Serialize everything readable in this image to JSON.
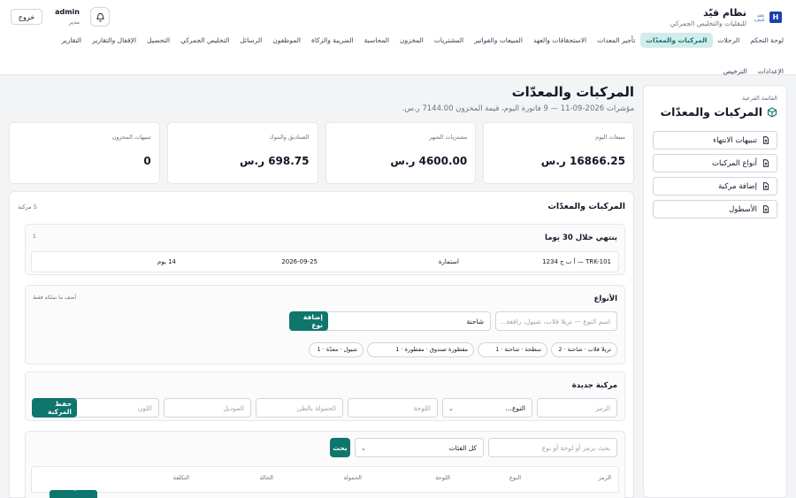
{
  "brand": {
    "logo_text": "H",
    "logo_tag": "ناقلة التجارة",
    "title": "نظام قيّد",
    "subtitle": "للنقليات والتخليص الجمركي"
  },
  "user": {
    "name": "admin",
    "role": "مدير",
    "logout_label": "خروج"
  },
  "nav": {
    "items": [
      "لوحة التحكم",
      "الرحلات",
      "المركبات والمعدّات",
      "تأجير المعدات",
      "الاستحقاقات والعهد",
      "المبيعات والفواتير",
      "المشتريات",
      "المخزون",
      "المحاسبة",
      "الضريبة والزكاة",
      "الموظفون",
      "الرسائل",
      "التخليص الجمركي",
      "التحصيل",
      "الإقفال والتقارير",
      "التقارير",
      "الإعدادات",
      "الترخيص"
    ],
    "active_index": 2
  },
  "sidebar": {
    "caption": "القائمة الفرعية",
    "title": "المركبات والمعدّات",
    "links": [
      "تنبيهات الانتهاء",
      "أنواع المركبات",
      "إضافة مركبة",
      "الأسطول"
    ]
  },
  "page": {
    "title": "المركبات والمعدّات",
    "meta": "مؤشرات 2026-09-11 — 9 فاتورة اليوم، قيمة المخزون 7144.00 ر.س."
  },
  "stats": [
    {
      "label": "مبيعات اليوم",
      "value": "16866.25 ر.س"
    },
    {
      "label": "مشتريات الشهر",
      "value": "4600.00 ر.س"
    },
    {
      "label": "الصناديق والبنوك",
      "value": "698.75 ر.س"
    },
    {
      "label": "تنبيهات المخزون",
      "value": "0"
    }
  ],
  "panel": {
    "title": "المركبات والمعدّات",
    "count": "5 مركبة"
  },
  "expiry": {
    "title": "ينتهي خلال 30 يوما",
    "count": "1",
    "row": {
      "vehicle": "TRK-101 — أ ب ج 1234",
      "doc": "استمارة",
      "date": "2026-09-25",
      "days": "14 يوم"
    }
  },
  "types": {
    "title": "الأنواع",
    "note": "أضف ما تملكه فقط",
    "name_placeholder": "اسم النوع — تريلا قلاب، شيول، رافعة…",
    "category_value": "شاحنة",
    "add_label": "إضافة نوع",
    "chips": [
      "تريلا قلاب · شاحنة · 2",
      "سطحة · شاحنة · 1",
      "مقطورة صندوق · مقطورة · 1",
      "شيول · معدّة · 1"
    ]
  },
  "new_vehicle": {
    "title": "مركبة جديدة",
    "code_placeholder": "الرمز",
    "type_value": "النوع…",
    "plate_placeholder": "اللوحة",
    "capacity_placeholder": "الحمولة بالطن",
    "model_placeholder": "الموديل",
    "color_placeholder": "اللون",
    "save_label": "حفظ المركبة"
  },
  "search": {
    "placeholder": "بحث برمز أو لوحة أو نوع",
    "category_value": "كل الفئات",
    "button_label": "بحث"
  },
  "table": {
    "columns": [
      "الرمز",
      "النوع",
      "اللوحة",
      "الحمولة",
      "الحالة",
      "التكلفة"
    ]
  }
}
